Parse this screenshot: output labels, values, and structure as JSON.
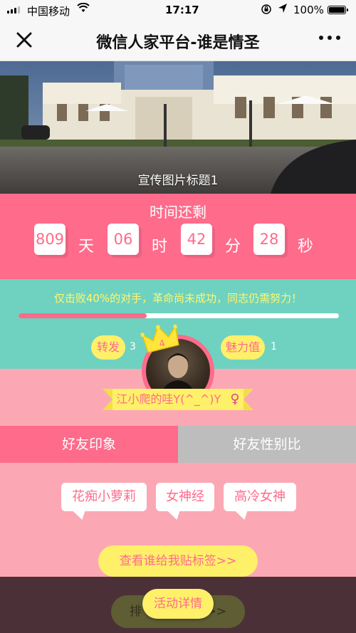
{
  "status_bar": {
    "carrier": "中国移动",
    "time": "17:17",
    "battery": "100%"
  },
  "navbar": {
    "title": "微信人家平台-谁是情圣"
  },
  "banner": {
    "caption": "宣传图片标题1"
  },
  "countdown": {
    "title": "时间还剩",
    "days": "809",
    "days_unit": "天",
    "hours": "06",
    "hours_unit": "时",
    "minutes": "42",
    "minutes_unit": "分",
    "seconds": "28",
    "seconds_unit": "秒"
  },
  "progress": {
    "message": "仅击败40%的对手，革命尚未成功，同志仍需努力！",
    "percent": 40
  },
  "stats": {
    "share_label": "转发",
    "share_count": "3",
    "charm_label": "魅力值",
    "charm_count": "1"
  },
  "profile": {
    "crown_number": "4",
    "name": "江小爬的哇Y(^_^)Y",
    "gender_symbol": "♀"
  },
  "tabs": [
    {
      "label": "好友印象",
      "active": true
    },
    {
      "label": "好友性别比",
      "active": false
    }
  ],
  "impressions": {
    "tags": [
      "花痴小萝莉",
      "女神经",
      "高冷女神"
    ],
    "see_tags_button": "查看谁给我贴标签>>"
  },
  "bottom": {
    "rank_left": "排",
    "rank_right": ">>",
    "activity_button": "活动详情"
  },
  "colors": {
    "pink": "#ff6b8b",
    "teal": "#6fd2c0",
    "light_pink": "#fba8b4",
    "yellow": "#fff06a",
    "dark": "#4b3137"
  }
}
